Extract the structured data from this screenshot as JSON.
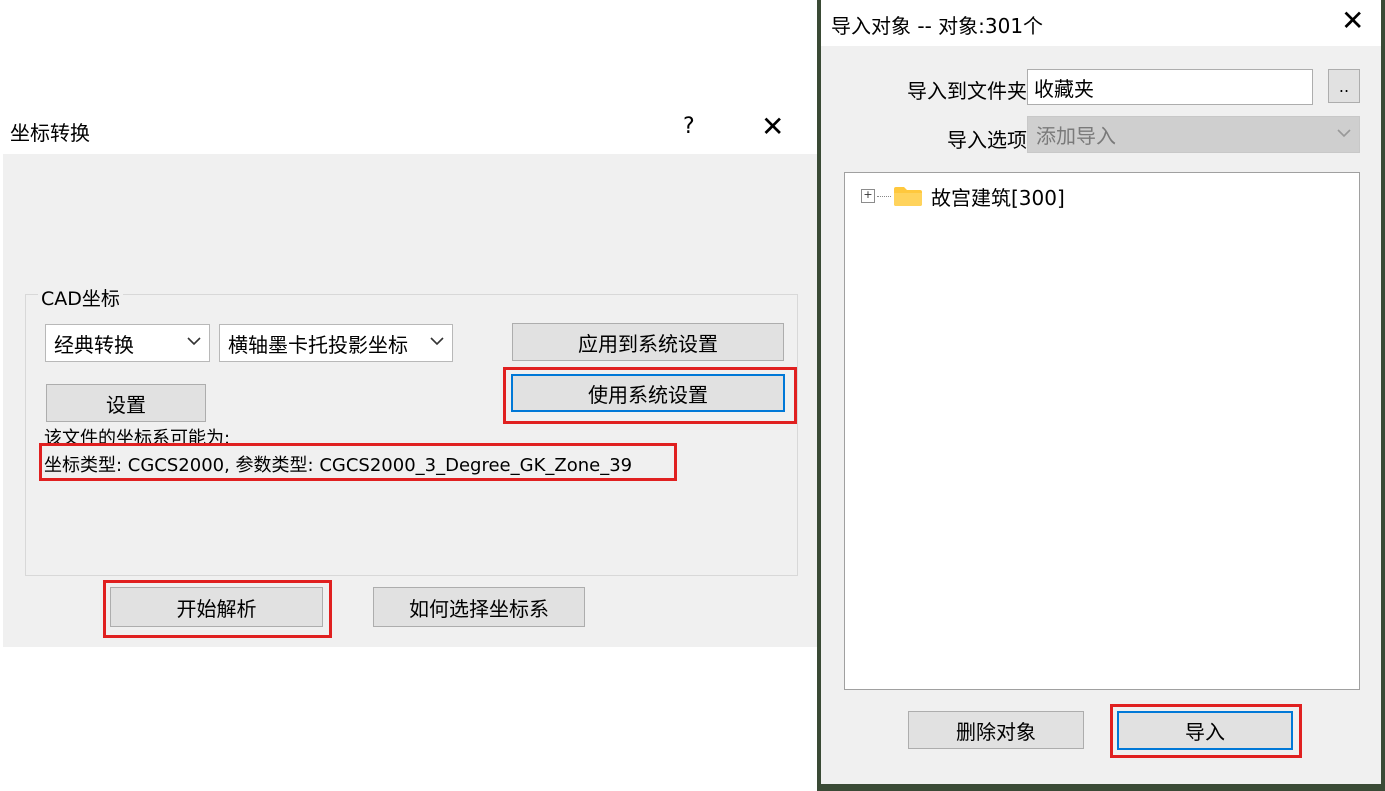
{
  "coord_dialog": {
    "title": "坐标转换",
    "help_glyph": "?",
    "close_glyph": "✕",
    "group_label": "CAD坐标",
    "combo_method": "经典转换",
    "combo_projection": "横轴墨卡托投影坐标",
    "apply_button": "应用到系统设置",
    "use_system_button": "使用系统设置",
    "settings_button": "设置",
    "hint_text": "该文件的坐标系可能为:",
    "detected_text": "坐标类型: CGCS2000, 参数类型: CGCS2000_3_Degree_GK_Zone_39",
    "start_button": "开始解析",
    "how_button": "如何选择坐标系"
  },
  "import_dialog": {
    "title": "导入对象 -- 对象:301个",
    "close_glyph": "✕",
    "folder_label": "导入到文件夹",
    "folder_value": "收藏夹",
    "browse_button": "..",
    "option_label": "导入选项",
    "option_value": "添加导入",
    "tree": [
      {
        "label": "故宫建筑[300]"
      }
    ],
    "delete_button": "删除对象",
    "import_button": "导入"
  },
  "colors": {
    "highlight": "#e02020",
    "focus": "#0078d7",
    "folder": "#ffc83d"
  }
}
